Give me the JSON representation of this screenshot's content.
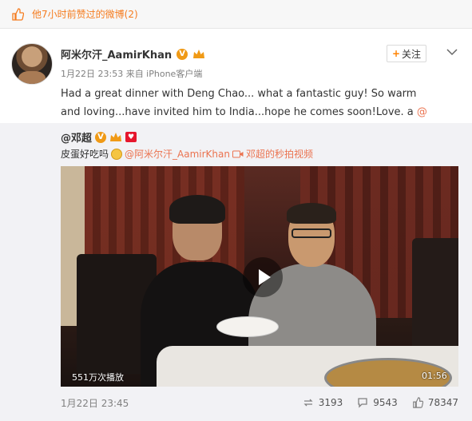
{
  "liked_banner": {
    "text": "他7小时前赞过的微博(2)"
  },
  "post": {
    "author": "阿米尔汗_AamirKhan",
    "verified_badge": "V",
    "meta": "1月22日 23:53 来自 iPhone客户端",
    "follow_label": "关注",
    "text_main": "Had a great dinner with Deng Chao... what a fantastic guy! So warm and loving...have invited him to India...hope he comes soon!Love. a ",
    "text_mention": "@邓超"
  },
  "repost": {
    "author": "@邓超",
    "verified_badge": "V",
    "text_start": "皮蛋好吃吗",
    "mention": "@阿米尔汗_AamirKhan",
    "video_link": "邓超的秒拍视频",
    "video": {
      "views": "551万次播放",
      "duration": "01:56"
    },
    "time": "1月22日 23:45",
    "reposts": "3193",
    "comments": "9543",
    "likes": "78347"
  },
  "colors": {
    "accent": "#eb7350",
    "orange": "#ff8200",
    "badge": "#f09a16"
  }
}
